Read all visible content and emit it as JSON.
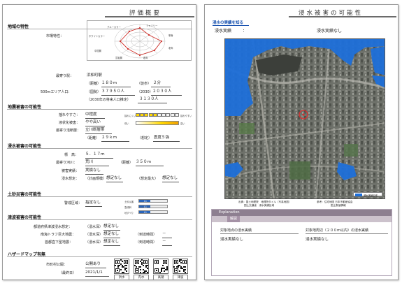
{
  "page1": {
    "title": "評価概要",
    "area_section": "地域の特性",
    "market_label": "市場特性：",
    "radar_labels": [
      "ブルーカラー",
      "ホワイトカラー",
      "ファミリー",
      "単身",
      "老年",
      "若年",
      "中間層",
      "富裕層"
    ],
    "station_label": "最寄り駅：",
    "station_value": "浜松町駅",
    "distance_label": "（距離）",
    "distance_value": "１８０ｍ",
    "walk_label": "（徒歩）",
    "walk_value": "２分",
    "pop_label": "500mエリア人口：",
    "pop_type_label": "（国勢）",
    "pop_value": "３７９５０人",
    "pop_2030_label": "（2030）",
    "pop_2030_value": "２０３０人",
    "pop_future_label": "（2030年の将来人口推定）",
    "pop_future_value": "３１３０人",
    "quake_section": "地震被害の可能性",
    "shake_label": "揺れやすさ：",
    "shake_value": "中程度",
    "shake_scale": [
      "揺れにくい",
      "揺れやすい"
    ],
    "shake_level": 0.5,
    "liquef_label": "液状化被害：",
    "liquef_value": "やや高い",
    "liquef_scale": [
      "低い",
      "高い"
    ],
    "fault_label": "最寄り活断層：",
    "fault_value": "立川断層帯",
    "fault_dist_label": "（距離）",
    "fault_dist_value": "２９ｋｍ",
    "fault_est_label": "（想定）",
    "fault_est_value": "震度５強",
    "flood_section": "浸水被害の可能性",
    "elev_label": "標　高：",
    "elev_value": "５．１７ｍ",
    "river_label": "最寄り河川：",
    "river_value": "荒川",
    "river_dist_label": "（距離）",
    "river_dist_value": "３５０ｍ",
    "record_label": "被害実績：",
    "record_value": "実績なし",
    "assume_label": "浸水想定：",
    "assume_plan_label": "（計画規模）",
    "assume_plan_value": "想定なし",
    "assume_max_label": "（想定最大）",
    "assume_max_value": "想定なし",
    "sediment_section": "土砂災害の可能性",
    "alert_label": "警戒区域：",
    "alert_value": "指定なし",
    "alert_bars": [
      {
        "label": "土砂災害",
        "code": "L1",
        "level": 0.4
      },
      {
        "label": "急傾斜",
        "code": "L1",
        "level": 0.4
      },
      {
        "label": "地すべり",
        "code": "L1",
        "level": 0.4
      }
    ],
    "tsunami_section": "津波被害の可能性",
    "t1_label": "都道府県津波浸水想定：",
    "t1_sub": "（浸水深）",
    "t1_value": "想定なし",
    "t2_label": "南海トラフ巨大地震：",
    "t2_sub": "（浸水深）",
    "t2_value": "想定なし",
    "t2_arr_label": "（到達時間）",
    "t2_arr_value": "－",
    "t3_label": "首都直下型地震：",
    "t3_sub": "（浸水深）",
    "t3_value": "想定なし",
    "t3_arr_label": "（到達時間）",
    "t3_arr_value": "－",
    "hazard_section": "ハザードマップ有無",
    "city_label": "市町村公開：",
    "city_value": "公開あり",
    "updated_label": "（最終日）",
    "updated_value": "2021/1/1",
    "qr_labels": [
      "洪水",
      "内水",
      "高潮",
      "津波"
    ]
  },
  "page2": {
    "title": "浸水被害の可能性",
    "subtitle": "浸水の実績を知る",
    "record_left_label": "浸水実績",
    "record_left_colon": "：",
    "record_right": "浸水実績なし",
    "legend": "浸水実績区域",
    "source1": "出典：国土地理院　地理院タイル（写真地図）",
    "source2": "国土交通省　浸水実績区域",
    "source3": "参考：住宅地図 日本不動産協会",
    "source4": "国土数値情報",
    "expl_title": "Explanation",
    "expl_sub": "解説",
    "col1_head": "対象地点の浸水実績",
    "col2_head": "対象地周辺（２００ｍ以内）の浸水実績",
    "col1_value": "浸水実績なし",
    "col2_value": "浸水実績なし"
  },
  "colors": {
    "flood_blue": "#1e6fd9",
    "shake_yellow": "#ffd700",
    "section_bar": "#aaaaaa",
    "explain_header": "#8d7f90"
  }
}
